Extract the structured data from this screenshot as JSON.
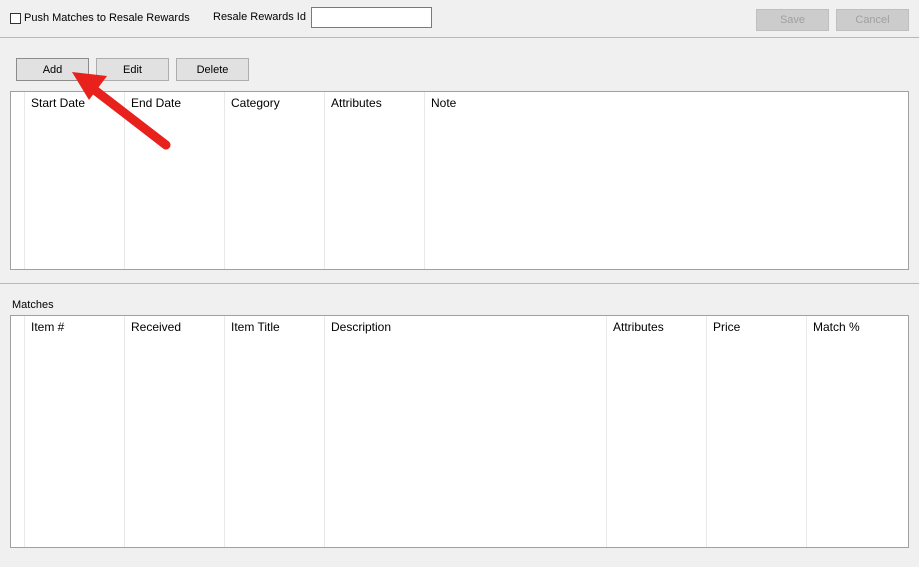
{
  "topbar": {
    "push_checkbox_label": "Push Matches to Resale Rewards",
    "push_checked": false,
    "resale_rewards_id_label": "Resale Rewards Id",
    "resale_rewards_id_value": "",
    "save_label": "Save",
    "cancel_label": "Cancel"
  },
  "toolbar": {
    "add_label": "Add",
    "edit_label": "Edit",
    "delete_label": "Delete"
  },
  "rules_grid": {
    "columns": [
      "Start Date",
      "End Date",
      "Category",
      "Attributes",
      "Note"
    ],
    "rows": []
  },
  "matches": {
    "section_label": "Matches",
    "columns": [
      "Item #",
      "Received",
      "Item Title",
      "Description",
      "Attributes",
      "Price",
      "Match %"
    ],
    "rows": []
  },
  "annotation": {
    "arrow_color": "#e8211c"
  }
}
